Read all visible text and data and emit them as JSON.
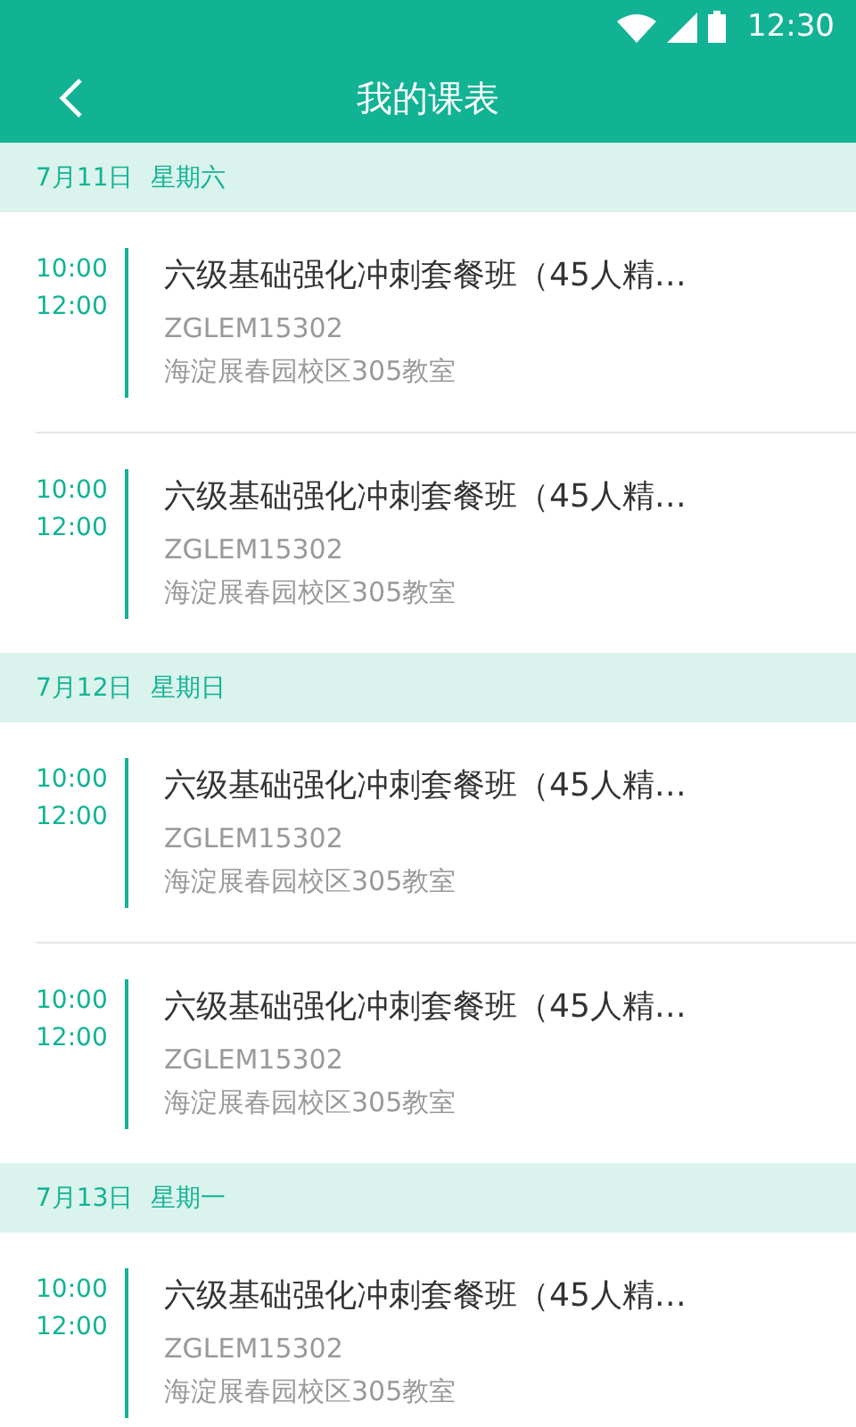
{
  "status_bar": {
    "time": "12:30"
  },
  "header": {
    "title": "我的课表"
  },
  "sections": [
    {
      "date": "7月11日",
      "weekday": "星期六",
      "lessons": [
        {
          "start": "10:00",
          "end": "12:00",
          "title": "六级基础强化冲刺套餐班（45人精…",
          "code": "ZGLEM15302",
          "location": "海淀展春园校区305教室"
        },
        {
          "start": "10:00",
          "end": "12:00",
          "title": "六级基础强化冲刺套餐班（45人精…",
          "code": "ZGLEM15302",
          "location": "海淀展春园校区305教室"
        }
      ]
    },
    {
      "date": "7月12日",
      "weekday": "星期日",
      "lessons": [
        {
          "start": "10:00",
          "end": "12:00",
          "title": "六级基础强化冲刺套餐班（45人精…",
          "code": "ZGLEM15302",
          "location": "海淀展春园校区305教室"
        },
        {
          "start": "10:00",
          "end": "12:00",
          "title": "六级基础强化冲刺套餐班（45人精…",
          "code": "ZGLEM15302",
          "location": "海淀展春园校区305教室"
        }
      ]
    },
    {
      "date": "7月13日",
      "weekday": "星期一",
      "lessons": [
        {
          "start": "10:00",
          "end": "12:00",
          "title": "六级基础强化冲刺套餐班（45人精…",
          "code": "ZGLEM15302",
          "location": "海淀展春园校区305教室"
        }
      ]
    }
  ]
}
